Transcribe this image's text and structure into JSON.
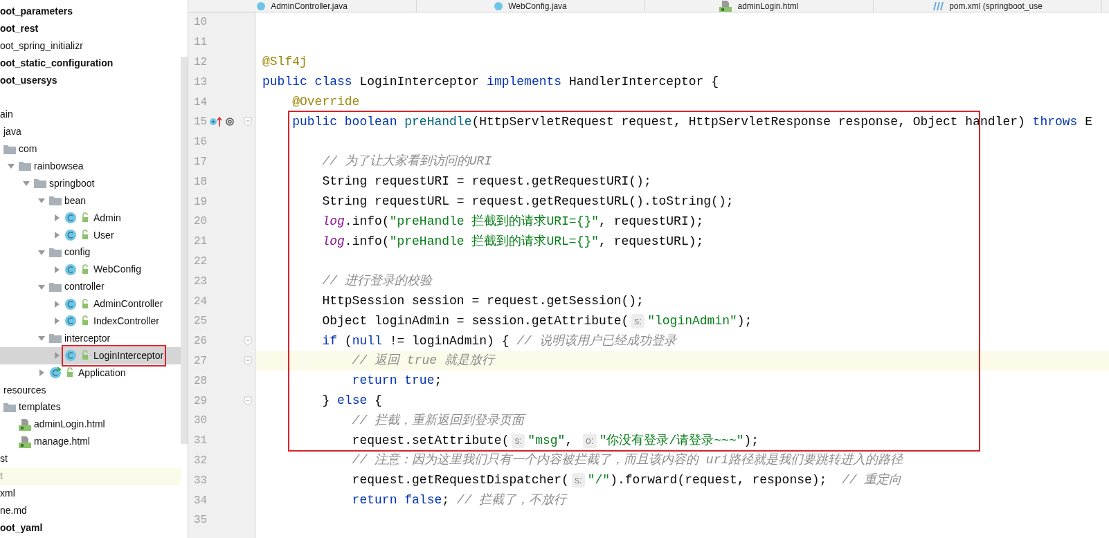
{
  "sidebar": {
    "modules": [
      {
        "label": "oot_parameters",
        "bold": true,
        "selected": false
      },
      {
        "label": "oot_rest",
        "bold": true,
        "selected": false
      },
      {
        "label": "oot_spring_initializr",
        "bold": false,
        "selected": false
      },
      {
        "label": "oot_static_configuration",
        "bold": true,
        "selected": false
      },
      {
        "label": "oot_usersys",
        "bold": true,
        "selected": false
      }
    ],
    "tree": [
      {
        "label": "ain",
        "selected": false,
        "children": [
          {
            "label": "java",
            "selected": false,
            "children": [
              {
                "label": "com",
                "kind": "folder",
                "selected": false,
                "children": [
                  {
                    "label": "rainbowsea",
                    "kind": "folder",
                    "expanded": true,
                    "selected": false,
                    "children": [
                      {
                        "label": "springboot",
                        "kind": "folder",
                        "expanded": true,
                        "selected": false,
                        "children": [
                          {
                            "label": "bean",
                            "kind": "folder",
                            "expanded": true,
                            "selected": false,
                            "children": [
                              {
                                "label": "Admin",
                                "kind": "class",
                                "expanded": false,
                                "selected": false
                              },
                              {
                                "label": "User",
                                "kind": "class",
                                "expanded": false,
                                "selected": false
                              }
                            ]
                          },
                          {
                            "label": "config",
                            "kind": "folder",
                            "expanded": true,
                            "selected": false,
                            "children": [
                              {
                                "label": "WebConfig",
                                "kind": "class",
                                "expanded": false,
                                "selected": false
                              }
                            ]
                          },
                          {
                            "label": "controller",
                            "kind": "folder",
                            "expanded": true,
                            "selected": false,
                            "children": [
                              {
                                "label": "AdminController",
                                "kind": "class",
                                "expanded": false,
                                "selected": false
                              },
                              {
                                "label": "IndexController",
                                "kind": "class",
                                "expanded": false,
                                "selected": false
                              }
                            ]
                          },
                          {
                            "label": "interceptor",
                            "kind": "folder",
                            "expanded": true,
                            "selected": false,
                            "children": [
                              {
                                "label": "LoginInterceptor",
                                "kind": "class",
                                "expanded": false,
                                "selected": true
                              }
                            ]
                          },
                          {
                            "label": "Application",
                            "kind": "app",
                            "expanded": false,
                            "selected": false
                          }
                        ]
                      }
                    ]
                  }
                ]
              }
            ]
          },
          {
            "label": "resources",
            "selected": false,
            "children": [
              {
                "label": "templates",
                "kind": "folder",
                "selected": false,
                "children": [
                  {
                    "label": "adminLogin.html",
                    "kind": "html",
                    "selected": false
                  },
                  {
                    "label": "manage.html",
                    "kind": "html",
                    "selected": false
                  }
                ]
              }
            ]
          }
        ]
      },
      {
        "label": "st",
        "selected": false
      },
      {
        "label": "t",
        "kind": "ignored",
        "selected": false
      },
      {
        "label": "xml",
        "selected": false
      },
      {
        "label": "ne.md",
        "selected": false
      },
      {
        "label": "oot_yaml",
        "bold": true,
        "selected": false
      }
    ]
  },
  "tabs": [
    {
      "label": "AdminController.java",
      "kind": "class"
    },
    {
      "label": "WebConfig.java",
      "kind": "class"
    },
    {
      "label": "adminLogin.html",
      "kind": "html"
    },
    {
      "label": "pom.xml (springboot_use",
      "kind": "maven"
    }
  ],
  "editor": {
    "lines": [
      {
        "number": "10",
        "current": false,
        "fold": false,
        "marker": false
      },
      {
        "number": "11",
        "current": false,
        "fold": false,
        "marker": false
      },
      {
        "number": "12",
        "current": false,
        "fold": false,
        "marker": false,
        "tokens": [
          {
            "kind": "ann",
            "text": "@Slf4j"
          }
        ]
      },
      {
        "number": "13",
        "current": false,
        "fold": false,
        "marker": false,
        "tokens": [
          {
            "kind": "kw",
            "text": "public class "
          },
          {
            "kind": "plain",
            "text": "LoginInterceptor "
          },
          {
            "kind": "kw",
            "text": "implements "
          },
          {
            "kind": "plain",
            "text": "HandlerInterceptor {"
          }
        ]
      },
      {
        "number": "14",
        "current": false,
        "fold": false,
        "marker": false,
        "tokens": [
          {
            "kind": "ann",
            "text": "    @Override"
          }
        ]
      },
      {
        "number": "15",
        "current": false,
        "fold": true,
        "marker": true,
        "tokens": [
          {
            "kind": "kw",
            "text": "    public boolean "
          },
          {
            "kind": "method",
            "text": "preHandle"
          },
          {
            "kind": "plain",
            "text": "(HttpServletRequest request, HttpServletResponse response, Object handler) "
          },
          {
            "kind": "kw",
            "text": "throws "
          },
          {
            "kind": "plain",
            "text": "E"
          }
        ]
      },
      {
        "number": "16",
        "current": false,
        "fold": false,
        "marker": false
      },
      {
        "number": "17",
        "current": false,
        "fold": false,
        "marker": false,
        "tokens": [
          {
            "kind": "com",
            "text": "        // 为了让大家看到访问的URI"
          }
        ]
      },
      {
        "number": "18",
        "current": false,
        "fold": false,
        "marker": false,
        "tokens": [
          {
            "kind": "plain",
            "text": "        String requestURI = request.getRequestURI();"
          }
        ]
      },
      {
        "number": "19",
        "current": false,
        "fold": false,
        "marker": false,
        "tokens": [
          {
            "kind": "plain",
            "text": "        String requestURL = request.getRequestURL().toString();"
          }
        ]
      },
      {
        "number": "20",
        "current": false,
        "fold": false,
        "marker": false,
        "tokens": [
          {
            "kind": "field",
            "text": "        log"
          },
          {
            "kind": "plain",
            "text": ".info("
          },
          {
            "kind": "str",
            "text": "\"preHandle 拦截到的请求URI={}\""
          },
          {
            "kind": "plain",
            "text": ", requestURI);"
          }
        ]
      },
      {
        "number": "21",
        "current": false,
        "fold": false,
        "marker": false,
        "tokens": [
          {
            "kind": "field",
            "text": "        log"
          },
          {
            "kind": "plain",
            "text": ".info("
          },
          {
            "kind": "str",
            "text": "\"preHandle 拦截到的请求URL={}\""
          },
          {
            "kind": "plain",
            "text": ", requestURL);"
          }
        ]
      },
      {
        "number": "22",
        "current": false,
        "fold": false,
        "marker": false
      },
      {
        "number": "23",
        "current": false,
        "fold": false,
        "marker": false,
        "tokens": [
          {
            "kind": "com",
            "text": "        // 进行登录的校验"
          }
        ]
      },
      {
        "number": "24",
        "current": false,
        "fold": false,
        "marker": false,
        "tokens": [
          {
            "kind": "plain",
            "text": "        HttpSession session = request.getSession();"
          }
        ]
      },
      {
        "number": "25",
        "current": false,
        "fold": false,
        "marker": false,
        "tokens": [
          {
            "kind": "plain",
            "text": "        Object loginAdmin = session.getAttribute("
          },
          {
            "kind": "hint",
            "text": "s:"
          },
          {
            "kind": "str",
            "text": "\"loginAdmin\""
          },
          {
            "kind": "plain",
            "text": ");"
          }
        ]
      },
      {
        "number": "26",
        "current": false,
        "fold": true,
        "marker": false,
        "tokens": [
          {
            "kind": "kw",
            "text": "        if "
          },
          {
            "kind": "plain",
            "text": "("
          },
          {
            "kind": "kw",
            "text": "null "
          },
          {
            "kind": "plain",
            "text": "!= loginAdmin) { "
          },
          {
            "kind": "com",
            "text": "// 说明该用户已经成功登录"
          }
        ]
      },
      {
        "number": "27",
        "current": true,
        "fold": true,
        "marker": false,
        "tokens": [
          {
            "kind": "com",
            "text": "            // 返回 true 就是放行"
          }
        ]
      },
      {
        "number": "28",
        "current": false,
        "fold": false,
        "marker": false,
        "tokens": [
          {
            "kind": "kw",
            "text": "            return true"
          },
          {
            "kind": "plain",
            "text": ";"
          }
        ]
      },
      {
        "number": "29",
        "current": false,
        "fold": true,
        "marker": false,
        "tokens": [
          {
            "kind": "plain",
            "text": "        } "
          },
          {
            "kind": "kw",
            "text": "else "
          },
          {
            "kind": "plain",
            "text": "{"
          }
        ]
      },
      {
        "number": "30",
        "current": false,
        "fold": false,
        "marker": false,
        "tokens": [
          {
            "kind": "com",
            "text": "            // 拦截，重新返回到登录页面"
          }
        ]
      },
      {
        "number": "31",
        "current": false,
        "fold": false,
        "marker": false,
        "tokens": [
          {
            "kind": "plain",
            "text": "            request.setAttribute("
          },
          {
            "kind": "hint",
            "text": "s:"
          },
          {
            "kind": "str",
            "text": "\"msg\""
          },
          {
            "kind": "plain",
            "text": ", "
          },
          {
            "kind": "hint",
            "text": "o:"
          },
          {
            "kind": "str",
            "text": "\"你没有登录/请登录~~~\""
          },
          {
            "kind": "plain",
            "text": ");"
          }
        ]
      },
      {
        "number": "32",
        "current": false,
        "fold": false,
        "marker": false,
        "tokens": [
          {
            "kind": "com",
            "text": "            // 注意：因为这里我们只有一个内容被拦截了，而且该内容的 uri路径就是我们要跳转进入的路径"
          }
        ]
      },
      {
        "number": "33",
        "current": false,
        "fold": false,
        "marker": false,
        "tokens": [
          {
            "kind": "plain",
            "text": "            request.getRequestDispatcher("
          },
          {
            "kind": "hint",
            "text": "s:"
          },
          {
            "kind": "str",
            "text": "\"/\""
          },
          {
            "kind": "plain",
            "text": ").forward(request, response);  "
          },
          {
            "kind": "com",
            "text": "// 重定向"
          }
        ]
      },
      {
        "number": "34",
        "current": false,
        "fold": false,
        "marker": false,
        "tokens": [
          {
            "kind": "kw",
            "text": "            return false"
          },
          {
            "kind": "plain",
            "text": "; "
          },
          {
            "kind": "com",
            "text": "// 拦截了，不放行"
          }
        ]
      },
      {
        "number": "35",
        "current": false,
        "fold": false,
        "marker": false
      }
    ]
  }
}
